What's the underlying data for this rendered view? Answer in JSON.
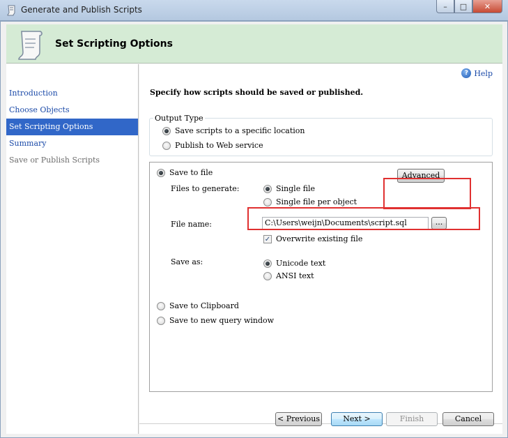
{
  "window": {
    "title": "Generate and Publish Scripts",
    "controls": {
      "minimize": "–",
      "maximize": "□",
      "close": "✕"
    }
  },
  "banner": {
    "title": "Set Scripting Options",
    "icon": "scroll-icon"
  },
  "nav": {
    "items": [
      {
        "label": "Introduction",
        "state": "link"
      },
      {
        "label": "Choose Objects",
        "state": "link"
      },
      {
        "label": "Set Scripting Options",
        "state": "active"
      },
      {
        "label": "Summary",
        "state": "link"
      },
      {
        "label": "Save or Publish Scripts",
        "state": "disabled"
      }
    ]
  },
  "main": {
    "help_label": "Help",
    "heading": "Specify how scripts should be saved or published.",
    "output_type": {
      "legend": "Output Type",
      "options": [
        {
          "label": "Save scripts to a specific location",
          "selected": true
        },
        {
          "label": "Publish to Web service",
          "selected": false
        }
      ]
    },
    "save_to_file": {
      "label": "Save to file",
      "selected": true,
      "advanced_button": "Advanced",
      "files_to_generate": {
        "label": "Files to generate:",
        "options": [
          {
            "label": "Single file",
            "selected": true
          },
          {
            "label": "Single file per object",
            "selected": false
          }
        ]
      },
      "file_name": {
        "label": "File name:",
        "value": "C:\\Users\\weijn\\Documents\\script.sql",
        "browse_button": "..."
      },
      "overwrite": {
        "label": "Overwrite existing file",
        "checked": true
      },
      "save_as": {
        "label": "Save as:",
        "options": [
          {
            "label": "Unicode text",
            "selected": true
          },
          {
            "label": "ANSI text",
            "selected": false
          }
        ]
      }
    },
    "save_to_clipboard": {
      "label": "Save to Clipboard",
      "selected": false
    },
    "save_to_query_window": {
      "label": "Save to new query window",
      "selected": false
    }
  },
  "footer": {
    "previous": "< Previous",
    "next": "Next >",
    "finish": "Finish",
    "cancel": "Cancel"
  },
  "colors": {
    "banner": "#d5ebd5",
    "nav_active": "#3167c8",
    "highlight_box": "#e03030"
  }
}
